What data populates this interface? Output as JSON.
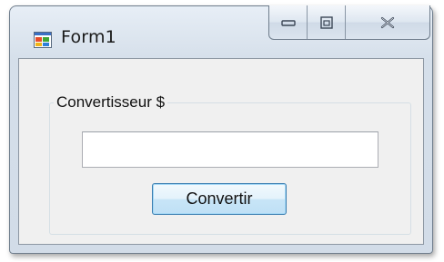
{
  "window": {
    "title": "Form1",
    "icon": "form-app-icon",
    "caption_buttons": {
      "minimize_icon": "minimize-icon",
      "maximize_icon": "maximize-icon",
      "close_icon": "close-icon"
    }
  },
  "group": {
    "label": "Convertisseur $"
  },
  "input": {
    "value": "",
    "placeholder": ""
  },
  "button": {
    "label": "Convertir"
  },
  "colors": {
    "frame": "#d5dfea",
    "client_bg": "#f0f0f0",
    "button_border": "#3c7fb1",
    "button_fill": "#c8e5f7"
  }
}
